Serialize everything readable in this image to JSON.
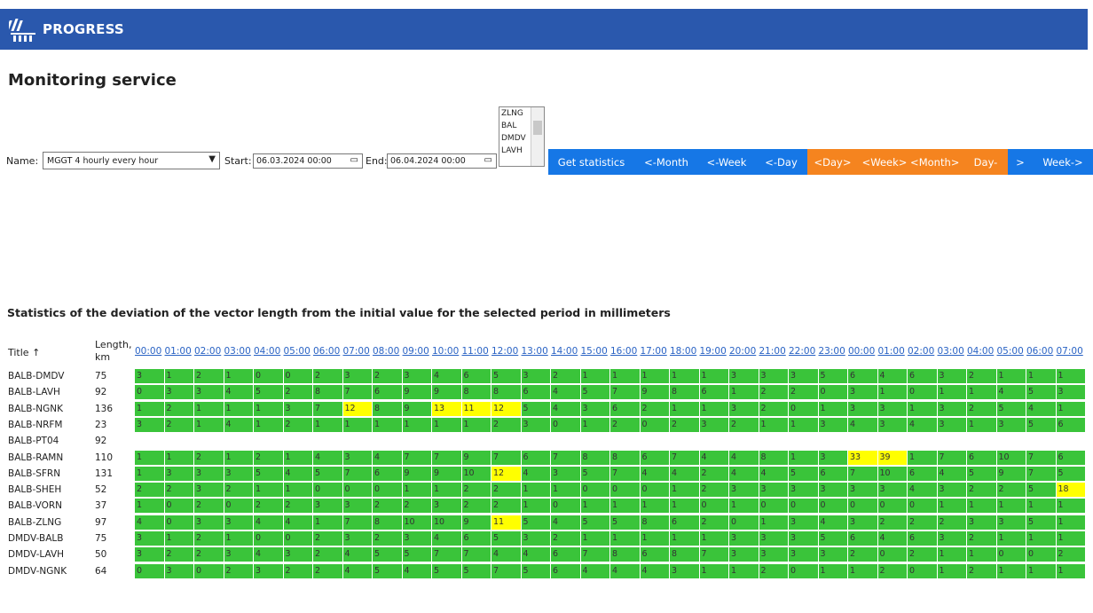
{
  "app": {
    "brand": "PROGRESS"
  },
  "page_title": "Monitoring service",
  "form": {
    "name_label": "Name:",
    "name_value": "MGGT 4 hourly every hour",
    "start_label": "Start:",
    "start_value": "06.03.2024 00:00",
    "end_label": "End:",
    "end_value": "06.04.2024 00:00",
    "listbox_options": [
      "ZLNG",
      "BAL",
      "DMDV",
      "LAVH"
    ]
  },
  "buttons": [
    {
      "label": "Get statistics",
      "color": "#1677e6"
    },
    {
      "label": "<-Month",
      "color": "#1677e6"
    },
    {
      "label": "<-Week",
      "color": "#1677e6"
    },
    {
      "label": "<-Day",
      "color": "#1677e6"
    },
    {
      "label": "<Day>",
      "color": "#f5841f"
    },
    {
      "label": "<Week> <Month>",
      "color": "#f5841f"
    },
    {
      "label": "Day-",
      "color": "#f5841f"
    },
    {
      "label": ">",
      "color": "#1677e6"
    },
    {
      "label": "Week->",
      "color": "#1677e6"
    }
  ],
  "stats_title": "Statistics of the deviation of the vector length from the initial value for the selected period in millimeters",
  "table": {
    "col_title": "Title ↑",
    "col_length": "Length, km",
    "hours": [
      "00:00",
      "01:00",
      "02:00",
      "03:00",
      "04:00",
      "05:00",
      "06:00",
      "07:00",
      "08:00",
      "09:00",
      "10:00",
      "11:00",
      "12:00",
      "13:00",
      "14:00",
      "15:00",
      "16:00",
      "17:00",
      "18:00",
      "19:00",
      "20:00",
      "21:00",
      "22:00",
      "23:00",
      "00:00",
      "01:00",
      "02:00",
      "03:00",
      "04:00",
      "05:00",
      "06:00",
      "07:00"
    ],
    "rows": [
      {
        "title": "BALB-DMDV",
        "length": "75",
        "values": [
          "3",
          "1",
          "2",
          "1",
          "0",
          "0",
          "2",
          "3",
          "2",
          "3",
          "4",
          "6",
          "5",
          "3",
          "2",
          "1",
          "1",
          "1",
          "1",
          "1",
          "3",
          "3",
          "3",
          "5",
          "6",
          "4",
          "6",
          "3",
          "2",
          "1",
          "1",
          "1"
        ]
      },
      {
        "title": "BALB-LAVH",
        "length": "92",
        "values": [
          "0",
          "3",
          "3",
          "4",
          "5",
          "2",
          "8",
          "7",
          "6",
          "9",
          "9",
          "8",
          "8",
          "6",
          "4",
          "5",
          "7",
          "9",
          "8",
          "6",
          "1",
          "2",
          "2",
          "0",
          "3",
          "1",
          "0",
          "1",
          "1",
          "4",
          "5",
          "3"
        ]
      },
      {
        "title": "BALB-NGNK",
        "length": "136",
        "values": [
          "1",
          "2",
          "1",
          "1",
          "1",
          "3",
          "7",
          "12",
          "8",
          "9",
          "13",
          "11",
          "12",
          "5",
          "4",
          "3",
          "6",
          "2",
          "1",
          "1",
          "3",
          "2",
          "0",
          "1",
          "3",
          "3",
          "1",
          "3",
          "2",
          "5",
          "4",
          "1"
        ]
      },
      {
        "title": "BALB-NRFM",
        "length": "23",
        "values": [
          "3",
          "2",
          "1",
          "4",
          "1",
          "2",
          "1",
          "1",
          "1",
          "1",
          "1",
          "1",
          "2",
          "3",
          "0",
          "1",
          "2",
          "0",
          "2",
          "3",
          "2",
          "1",
          "1",
          "3",
          "4",
          "3",
          "4",
          "3",
          "1",
          "3",
          "5",
          "6"
        ]
      },
      {
        "title": "BALB-PT04",
        "length": "92",
        "values": []
      },
      {
        "title": "BALB-RAMN",
        "length": "110",
        "values": [
          "1",
          "1",
          "2",
          "1",
          "2",
          "1",
          "4",
          "3",
          "4",
          "7",
          "7",
          "9",
          "7",
          "6",
          "7",
          "8",
          "8",
          "6",
          "7",
          "4",
          "4",
          "8",
          "1",
          "3",
          "33",
          "39",
          "1",
          "7",
          "6",
          "10",
          "7",
          "6"
        ]
      },
      {
        "title": "BALB-SFRN",
        "length": "131",
        "values": [
          "1",
          "3",
          "3",
          "3",
          "5",
          "4",
          "5",
          "7",
          "6",
          "9",
          "9",
          "10",
          "12",
          "4",
          "3",
          "5",
          "7",
          "4",
          "4",
          "2",
          "4",
          "4",
          "5",
          "6",
          "7",
          "10",
          "6",
          "4",
          "5",
          "9",
          "7",
          "5"
        ]
      },
      {
        "title": "BALB-SHEH",
        "length": "52",
        "values": [
          "2",
          "2",
          "3",
          "2",
          "1",
          "1",
          "0",
          "0",
          "0",
          "1",
          "1",
          "2",
          "2",
          "1",
          "1",
          "0",
          "0",
          "0",
          "1",
          "2",
          "3",
          "3",
          "3",
          "3",
          "3",
          "3",
          "4",
          "3",
          "2",
          "2",
          "5",
          "18"
        ]
      },
      {
        "title": "BALB-VORN",
        "length": "37",
        "values": [
          "1",
          "0",
          "2",
          "0",
          "2",
          "2",
          "3",
          "3",
          "2",
          "2",
          "3",
          "2",
          "2",
          "1",
          "0",
          "1",
          "1",
          "1",
          "1",
          "0",
          "1",
          "0",
          "0",
          "0",
          "0",
          "0",
          "0",
          "1",
          "1",
          "1",
          "1",
          "1"
        ]
      },
      {
        "title": "BALB-ZLNG",
        "length": "97",
        "values": [
          "4",
          "0",
          "3",
          "3",
          "4",
          "4",
          "1",
          "7",
          "8",
          "10",
          "10",
          "9",
          "11",
          "5",
          "4",
          "5",
          "5",
          "8",
          "6",
          "2",
          "0",
          "1",
          "3",
          "4",
          "3",
          "2",
          "2",
          "2",
          "3",
          "3",
          "5",
          "1"
        ]
      },
      {
        "title": "DMDV-BALB",
        "length": "75",
        "values": [
          "3",
          "1",
          "2",
          "1",
          "0",
          "0",
          "2",
          "3",
          "2",
          "3",
          "4",
          "6",
          "5",
          "3",
          "2",
          "1",
          "1",
          "1",
          "1",
          "1",
          "3",
          "3",
          "3",
          "5",
          "6",
          "4",
          "6",
          "3",
          "2",
          "1",
          "1",
          "1"
        ]
      },
      {
        "title": "DMDV-LAVH",
        "length": "50",
        "values": [
          "3",
          "2",
          "2",
          "3",
          "4",
          "3",
          "2",
          "4",
          "5",
          "5",
          "7",
          "7",
          "4",
          "4",
          "6",
          "7",
          "8",
          "6",
          "8",
          "7",
          "3",
          "3",
          "3",
          "3",
          "2",
          "0",
          "2",
          "1",
          "1",
          "0",
          "0",
          "2"
        ]
      },
      {
        "title": "DMDV-NGNK",
        "length": "64",
        "values": [
          "0",
          "3",
          "0",
          "2",
          "3",
          "2",
          "2",
          "4",
          "5",
          "4",
          "5",
          "5",
          "7",
          "5",
          "6",
          "4",
          "4",
          "4",
          "3",
          "1",
          "1",
          "2",
          "0",
          "1",
          "1",
          "2",
          "0",
          "1",
          "2",
          "1",
          "1",
          "1"
        ]
      }
    ],
    "highlight_threshold": 11,
    "colors": {
      "normal": "#3ac43a",
      "warning": "#ffff00"
    }
  }
}
